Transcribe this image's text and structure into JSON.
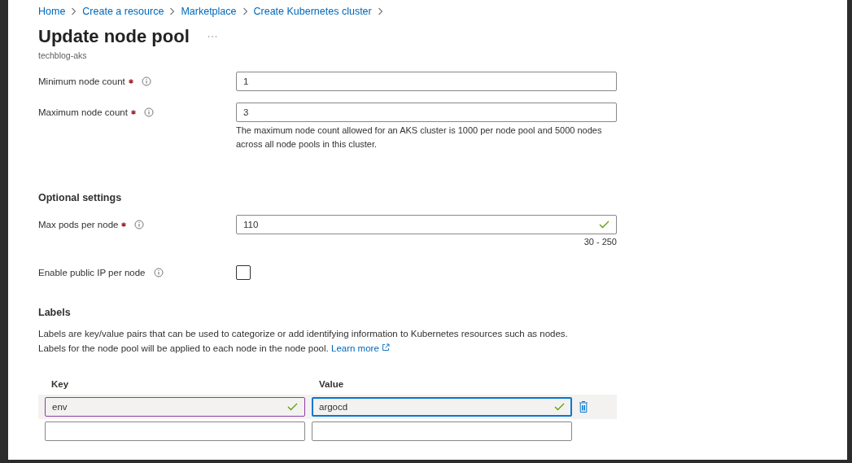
{
  "breadcrumbs": [
    "Home",
    "Create a resource",
    "Marketplace",
    "Create Kubernetes cluster"
  ],
  "title": "Update node pool",
  "subtitle": "techblog-aks",
  "fields": [
    {
      "kind": "text",
      "label": "Minimum node count",
      "required": true,
      "value": "1",
      "valid": false
    },
    {
      "kind": "text",
      "label": "Maximum node count",
      "required": true,
      "value": "3",
      "valid": false,
      "help": "The maximum node count allowed for an AKS cluster is 1000 per node pool and 5000 nodes across all node pools in this cluster."
    }
  ],
  "optional_settings": {
    "heading": "Optional settings",
    "fields": [
      {
        "kind": "text",
        "label": "Max pods per node",
        "required": true,
        "value": "110",
        "valid": true,
        "range": "30 - 250"
      },
      {
        "kind": "checkbox",
        "label": "Enable public IP per node",
        "checked": false
      }
    ]
  },
  "labels": {
    "heading": "Labels",
    "description": [
      "Labels are key/value pairs that can be used to categorize or add identifying information to Kubernetes resources such as nodes.",
      "Labels for the node pool will be applied to each node in the node pool."
    ],
    "link": "Learn more",
    "columns": [
      "Key",
      "Value"
    ],
    "rows": [
      {
        "selected": true,
        "deletable": true,
        "key": {
          "value": "env",
          "valid": true,
          "hovered": true,
          "focused": false
        },
        "value": {
          "value": "argocd",
          "valid": true,
          "hovered": false,
          "focused": true
        }
      },
      {
        "selected": false,
        "deletable": false,
        "key": {
          "valid": false,
          "hovered": false,
          "focused": false
        },
        "value": {
          "valid": false,
          "hovered": false,
          "focused": false
        }
      }
    ]
  }
}
